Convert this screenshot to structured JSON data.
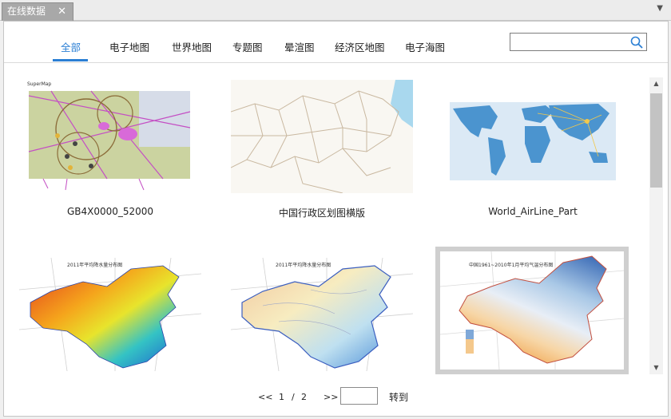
{
  "tab": {
    "title": "在线数据",
    "close": "✕"
  },
  "nav": {
    "tabs": [
      "全部",
      "电子地图",
      "世界地图",
      "专题图",
      "晕渲图",
      "经济区地图",
      "电子海图"
    ],
    "active": "全部"
  },
  "search": {
    "value": "",
    "placeholder": ""
  },
  "cards": [
    {
      "caption": "GB4X0000_52000",
      "thumb_label": "SuperMap"
    },
    {
      "caption": "中国行政区划图横版",
      "thumb_label": ""
    },
    {
      "caption": "World_AirLine_Part",
      "thumb_label": ""
    },
    {
      "caption": "",
      "thumb_label": "2011年平均降水量分布图"
    },
    {
      "caption": "",
      "thumb_label": "2011年平均降水量分布图"
    },
    {
      "caption": "",
      "thumb_label": "中国1961~2010年1月平均气温分布图"
    }
  ],
  "pager": {
    "prev": "<<",
    "current": "1",
    "separator": "/",
    "total": "2",
    "next": ">>",
    "page_input": "",
    "go_label": "转到"
  },
  "colors": {
    "accent": "#2b7fd4",
    "tab_bg": "#a8a8a8",
    "ocean": "#4b94cf"
  }
}
